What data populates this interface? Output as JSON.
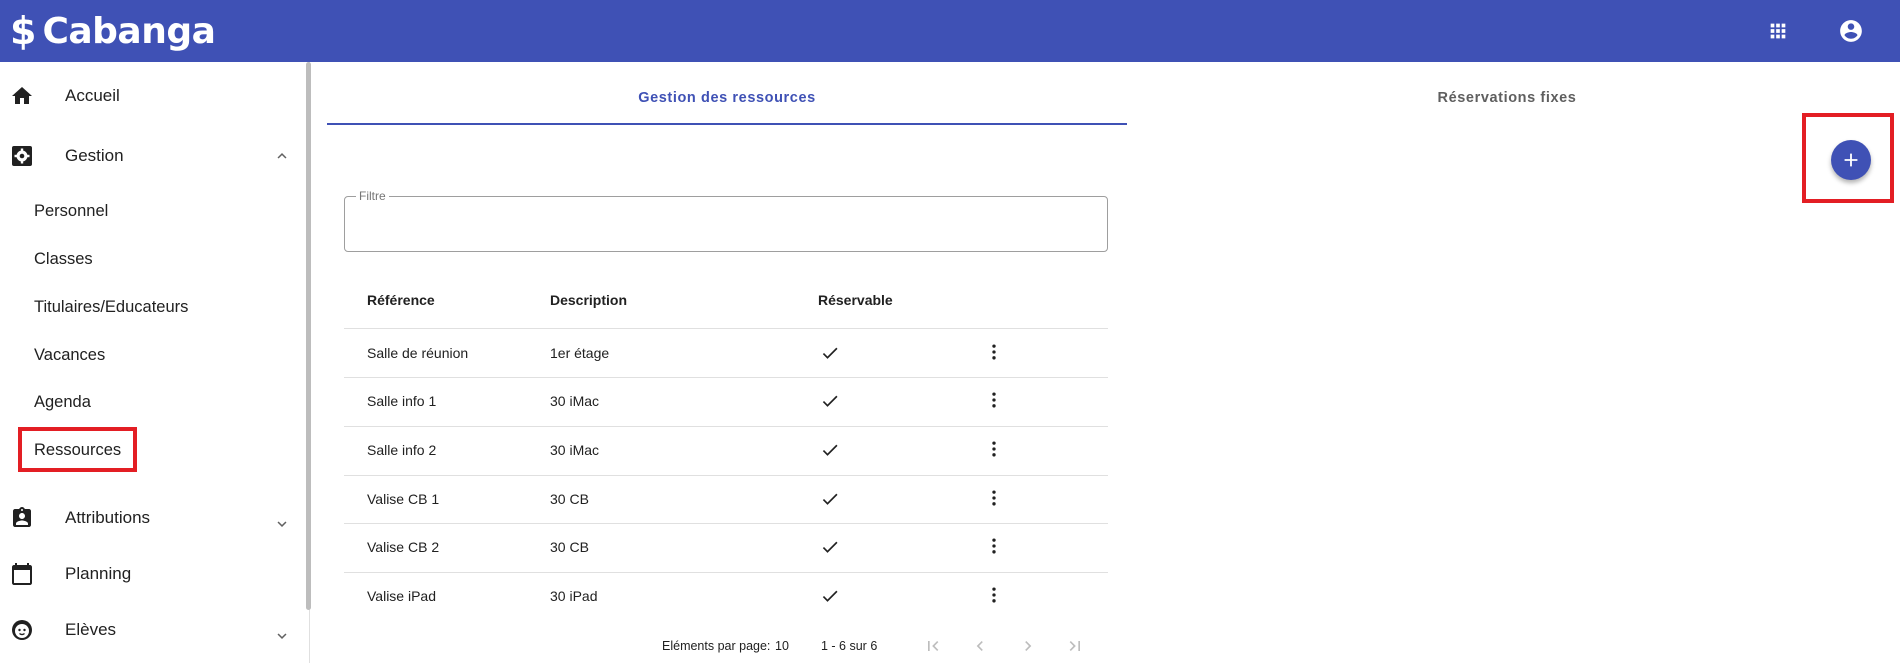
{
  "app": {
    "logo_symbol": "$",
    "brand": "Cabanga",
    "colors": {
      "primary": "#3f51b5",
      "highlight": "#e31e24"
    }
  },
  "topbar": {
    "apps_icon": "apps-grid-icon",
    "account_icon": "account-circle-icon"
  },
  "sidebar": {
    "items": [
      {
        "label": "Accueil",
        "icon": "home-icon"
      },
      {
        "label": "Gestion",
        "icon": "settings-box-icon",
        "expanded": true
      },
      {
        "label": "Attributions",
        "icon": "assignment-ind-icon"
      },
      {
        "label": "Planning",
        "icon": "calendar-icon"
      },
      {
        "label": "Elèves",
        "icon": "child-face-icon"
      }
    ],
    "gestion_children": [
      "Personnel",
      "Classes",
      "Titulaires/Educateurs",
      "Vacances",
      "Agenda",
      "Ressources"
    ]
  },
  "tabs": [
    {
      "label": "Gestion des ressources",
      "active": true
    },
    {
      "label": "Réservations fixes",
      "active": false
    }
  ],
  "filter": {
    "label": "Filtre",
    "value": ""
  },
  "table": {
    "headers": [
      "Référence",
      "Description",
      "Réservable"
    ],
    "rows": [
      {
        "reference": "Salle de réunion",
        "description": "1er étage",
        "reservable": true
      },
      {
        "reference": "Salle info 1",
        "description": "30 iMac",
        "reservable": true
      },
      {
        "reference": "Salle info 2",
        "description": "30 iMac",
        "reservable": true
      },
      {
        "reference": "Valise CB 1",
        "description": "30 CB",
        "reservable": true
      },
      {
        "reference": "Valise CB 2",
        "description": "30 CB",
        "reservable": true
      },
      {
        "reference": "Valise iPad",
        "description": "30 iPad",
        "reservable": true
      }
    ]
  },
  "paginator": {
    "page_size_label": "Eléments par page:",
    "page_size": "10",
    "range": "1 - 6 sur 6"
  },
  "fab": {
    "icon": "add-icon"
  }
}
